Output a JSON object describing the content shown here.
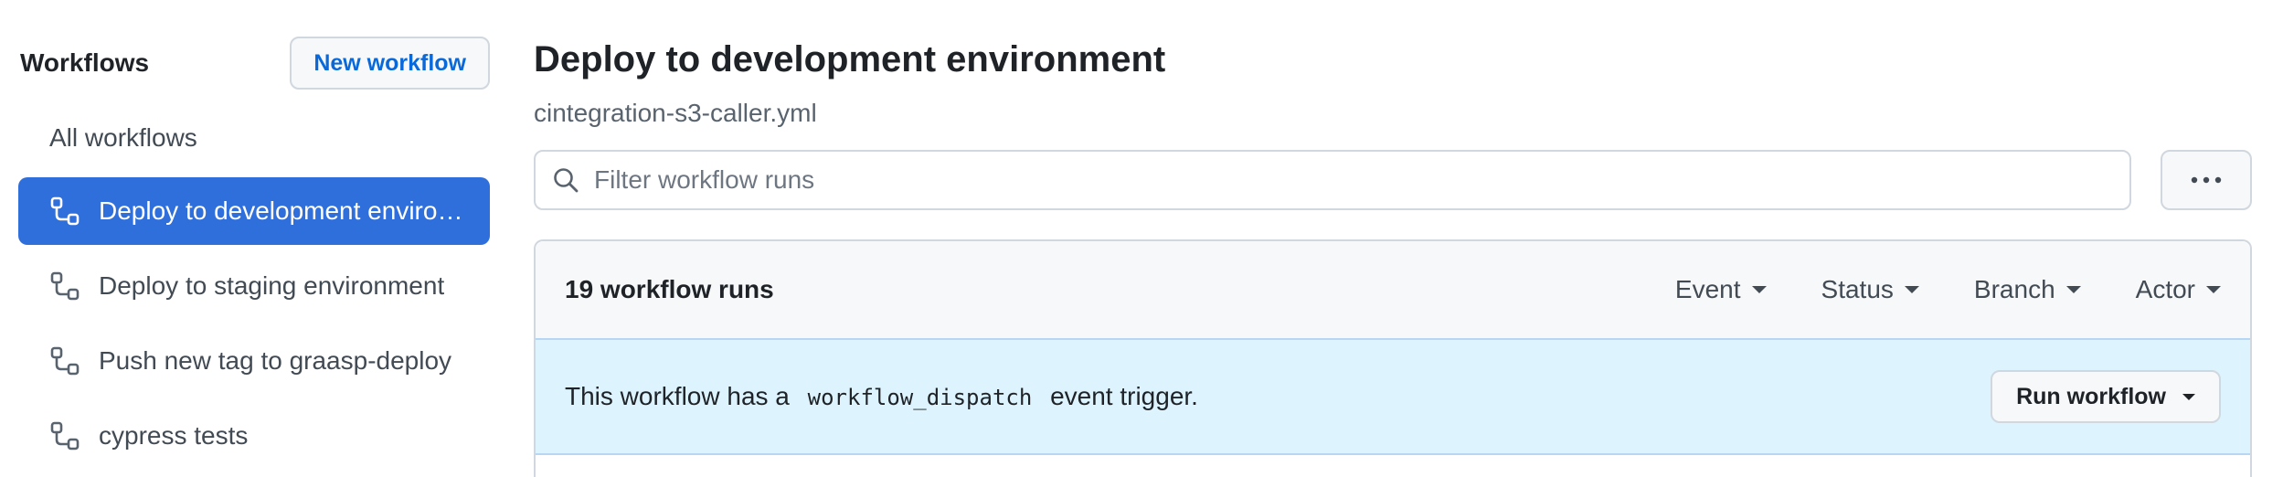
{
  "sidebar": {
    "title": "Workflows",
    "new_button": "New workflow",
    "all_label": "All workflows",
    "items": [
      {
        "label": "Deploy to development environment",
        "active": true
      },
      {
        "label": "Deploy to staging environment",
        "active": false
      },
      {
        "label": "Push new tag to graasp-deploy",
        "active": false
      },
      {
        "label": "cypress tests",
        "active": false
      }
    ]
  },
  "main": {
    "title": "Deploy to development environment",
    "file": "cintegration-s3-caller.yml",
    "filter_placeholder": "Filter workflow runs",
    "runs_count": "19 workflow runs",
    "filters": [
      "Event",
      "Status",
      "Branch",
      "Actor"
    ],
    "dispatch": {
      "prefix": "This workflow has a",
      "code": "workflow_dispatch",
      "suffix": "event trigger."
    },
    "run_button": "Run workflow"
  },
  "colors": {
    "accent": "#2f6fdc",
    "link": "#0969da",
    "info_bg": "#ddf4ff"
  },
  "icons": [
    "workflow-icon",
    "search-icon",
    "kebab-horizontal-icon",
    "triangle-down-icon"
  ]
}
